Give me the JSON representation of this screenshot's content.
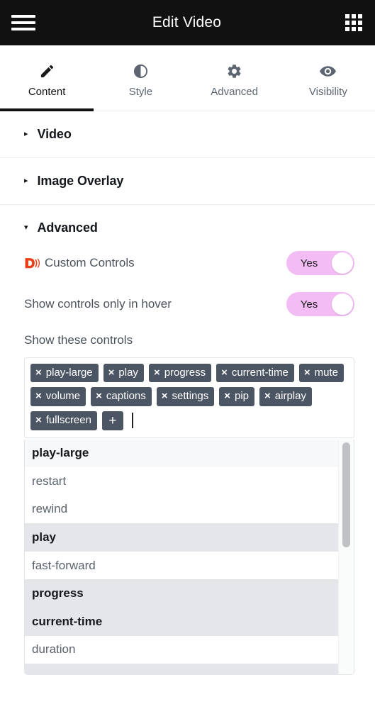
{
  "topbar": {
    "menu_icon": "hamburger-icon",
    "title": "Edit Video",
    "apps_icon": "grid-apps-icon"
  },
  "tabs": [
    {
      "label": "Content",
      "icon": "pencil-icon",
      "active": true
    },
    {
      "label": "Style",
      "icon": "contrast-icon",
      "active": false
    },
    {
      "label": "Advanced",
      "icon": "gear-icon",
      "active": false
    },
    {
      "label": "Visibility",
      "icon": "eye-icon",
      "active": false
    }
  ],
  "sections": [
    {
      "title": "Video",
      "expanded": false,
      "caret": "▸"
    },
    {
      "title": "Image Overlay",
      "expanded": false,
      "caret": "▸"
    },
    {
      "title": "Advanced",
      "expanded": true,
      "caret": "▾"
    }
  ],
  "advanced": {
    "rows": [
      {
        "label": "Custom Controls",
        "icon": "dailymotion-d-icon",
        "toggle_value": "Yes"
      },
      {
        "label": "Show controls only in hover",
        "icon": null,
        "toggle_value": "Yes"
      }
    ],
    "controls_field": {
      "label": "Show these controls",
      "chips": [
        "play-large",
        "play",
        "progress",
        "current-time",
        "mute",
        "volume",
        "captions",
        "settings",
        "pip",
        "airplay",
        "fullscreen"
      ],
      "remove_glyph": "×",
      "add_glyph": "+",
      "input_value": ""
    },
    "dropdown": {
      "options": [
        {
          "label": "play-large",
          "selected": true,
          "hovered": true
        },
        {
          "label": "restart",
          "selected": false,
          "hovered": false
        },
        {
          "label": "rewind",
          "selected": false,
          "hovered": false
        },
        {
          "label": "play",
          "selected": true,
          "hovered": false
        },
        {
          "label": "fast-forward",
          "selected": false,
          "hovered": false
        },
        {
          "label": "progress",
          "selected": true,
          "hovered": false
        },
        {
          "label": "current-time",
          "selected": true,
          "hovered": false
        },
        {
          "label": "duration",
          "selected": false,
          "hovered": false
        },
        {
          "label": "",
          "selected": true,
          "hovered": false
        }
      ]
    }
  },
  "colors": {
    "topbar_bg": "#111111",
    "accent_toggle": "#f3bcf5",
    "chip_bg": "#4c5564",
    "brand_red": "#ea3f16",
    "selected_row_bg": "#e4e6e9"
  }
}
